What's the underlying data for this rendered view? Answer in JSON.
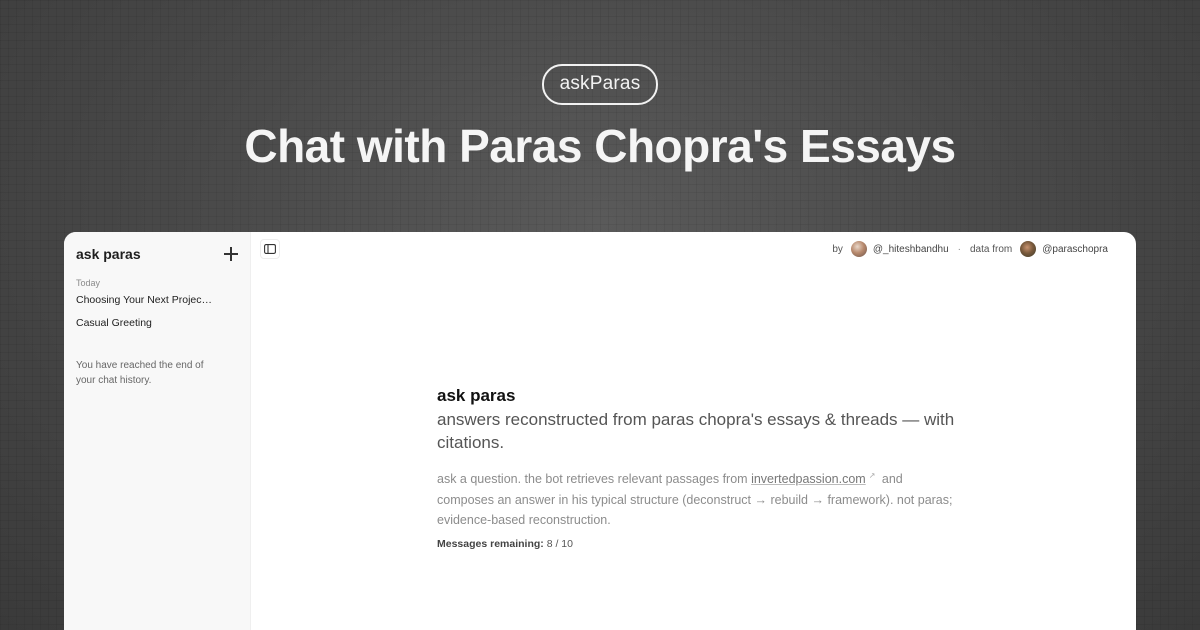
{
  "hero": {
    "pill": "askParas",
    "title": "Chat with Paras Chopra's Essays"
  },
  "sidebar": {
    "app_name": "ask paras",
    "new_chat_icon": "plus-icon",
    "section_label": "Today",
    "chats": [
      {
        "title": "Choosing Your Next Project: T..."
      },
      {
        "title": "Casual Greeting"
      }
    ],
    "end_note": "You have reached the end of your chat history."
  },
  "header": {
    "toggle_icon": "sidebar-toggle-icon",
    "by_label": "by",
    "author_handle": "@_hiteshbandhu",
    "separator": "·",
    "data_from_label": "data from",
    "source_handle": "@paraschopra"
  },
  "intro": {
    "title": "ask paras",
    "subtitle": "answers reconstructed from paras chopra's essays & threads — with citations.",
    "desc_part1": "ask a question. the bot retrieves relevant passages from ",
    "desc_link": "invertedpassion.com",
    "desc_link_icon": "external-link-icon",
    "desc_part2": " and composes an answer in his typical structure (deconstruct → rebuild → framework). not paras; evidence-based reconstruction.",
    "remaining_label": "Messages remaining:",
    "remaining_value": "8 / 10"
  },
  "colors": {
    "background": "#4a4a4a",
    "window": "#ffffff",
    "sidebar": "#f8f8f8",
    "hero_text": "#f5f5f5"
  }
}
